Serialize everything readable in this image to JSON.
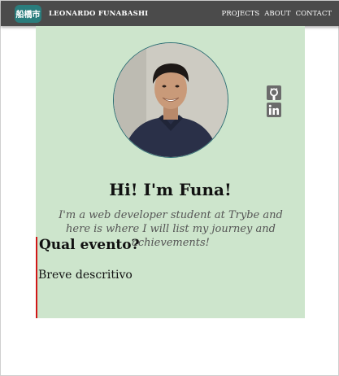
{
  "navbar": {
    "logo_text": "船橋市",
    "brand_name": "LEONARDO FUNABASHI",
    "links": [
      "PROJECTS",
      "ABOUT",
      "CONTACT"
    ]
  },
  "profile": {
    "heading": "Hi! I'm Funa!",
    "subtitle": "I'm a web developer student at Trybe and here is where I will list my journey and achievements!"
  },
  "social": {
    "icons": [
      "github-icon",
      "linkedin-icon"
    ]
  },
  "event": {
    "title": "Qual evento?",
    "description": "Breve descritivo"
  },
  "colors": {
    "navbar": "#4b4b4b",
    "logo_bg": "#2a7d7d",
    "main_bg": "#cde5cc",
    "timeline_line": "#d01818",
    "icon": "#6b6b6b"
  }
}
